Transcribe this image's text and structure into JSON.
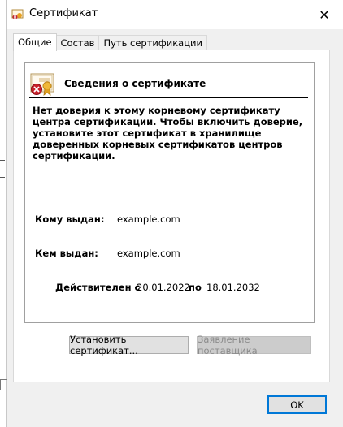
{
  "window": {
    "title": "Сертификат",
    "close_glyph": "✕"
  },
  "tabs": [
    {
      "label": "Общие"
    },
    {
      "label": "Состав"
    },
    {
      "label": "Путь сертификации"
    }
  ],
  "info": {
    "title": "Сведения о сертификате",
    "warning": "Нет доверия к этому корневому сертификату\nцентра сертификации. Чтобы включить  доверие,\nустановите этот сертификат в хранилище\nдоверенных корневых сертификатов центров\nсертификации."
  },
  "details": {
    "issued_to_label": "Кому выдан:",
    "issued_to_value": "example.com",
    "issued_by_label": "Кем выдан:",
    "issued_by_value": "example.com",
    "valid_label": "Действителен с",
    "valid_from": "20.01.2022",
    "valid_to_label": "по",
    "valid_to": "18.01.2032"
  },
  "buttons": {
    "install": "Установить сертификат...",
    "issuer_statement": "Заявление поставщика",
    "ok": "OK"
  },
  "icons": {
    "app": "certificate-warning-icon",
    "cert": "certificate-error-icon",
    "close": "close-icon"
  }
}
